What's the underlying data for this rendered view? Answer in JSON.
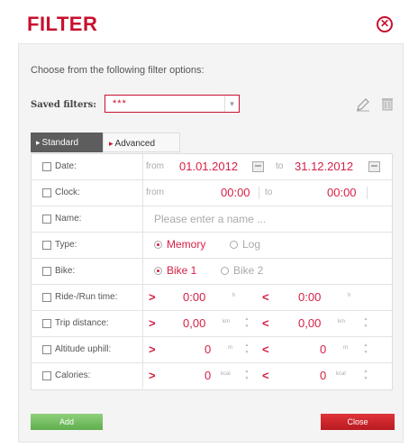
{
  "dialog": {
    "title": "FILTER",
    "intro": "Choose from the following filter options:"
  },
  "saved_filters": {
    "label": "Saved filters:",
    "value": "***"
  },
  "tabs": [
    {
      "label": "Standard",
      "active": true
    },
    {
      "label": "Advanced",
      "active": false
    }
  ],
  "rows": {
    "date": {
      "label": "Date:",
      "from_text": "from",
      "from_value": "01.01.2012",
      "to_text": "to",
      "to_value": "31.12.2012"
    },
    "clock": {
      "label": "Clock:",
      "from_text": "from",
      "from_value": "00:00",
      "to_text": "to",
      "to_value": "00:00"
    },
    "name": {
      "label": "Name:",
      "placeholder": "Please enter a name ..."
    },
    "type": {
      "label": "Type:",
      "options": [
        "Memory",
        "Log"
      ],
      "selected": "Memory"
    },
    "bike": {
      "label": "Bike:",
      "options": [
        "Bike 1",
        "Bike 2"
      ],
      "selected": "Bike 1"
    },
    "ride_time": {
      "label": "Ride-/Run time:",
      "gt": ">",
      "min_value": "0:00",
      "min_unit": "h",
      "lt": "<",
      "max_value": "0:00",
      "max_unit": "h"
    },
    "trip_distance": {
      "label": "Trip distance:",
      "gt": ">",
      "min_value": "0,00",
      "min_unit": "km",
      "lt": "<",
      "max_value": "0,00",
      "max_unit": "km"
    },
    "altitude": {
      "label": "Altitude uphill:",
      "gt": ">",
      "min_value": "0",
      "min_unit": "m",
      "lt": "<",
      "max_value": "0",
      "max_unit": "m"
    },
    "calories": {
      "label": "Calories:",
      "gt": ">",
      "min_value": "0",
      "min_unit": "kcal",
      "lt": "<",
      "max_value": "0",
      "max_unit": "kcal"
    }
  },
  "buttons": {
    "add": "Add",
    "close": "Close"
  },
  "colors": {
    "accent": "#c8102e",
    "value": "#d61f45",
    "add": "#6ab858",
    "close": "#c8202a"
  },
  "icons": {
    "close": "close-circle-icon",
    "edit": "pencil-icon",
    "delete": "trash-icon",
    "calendar": "calendar-icon"
  }
}
